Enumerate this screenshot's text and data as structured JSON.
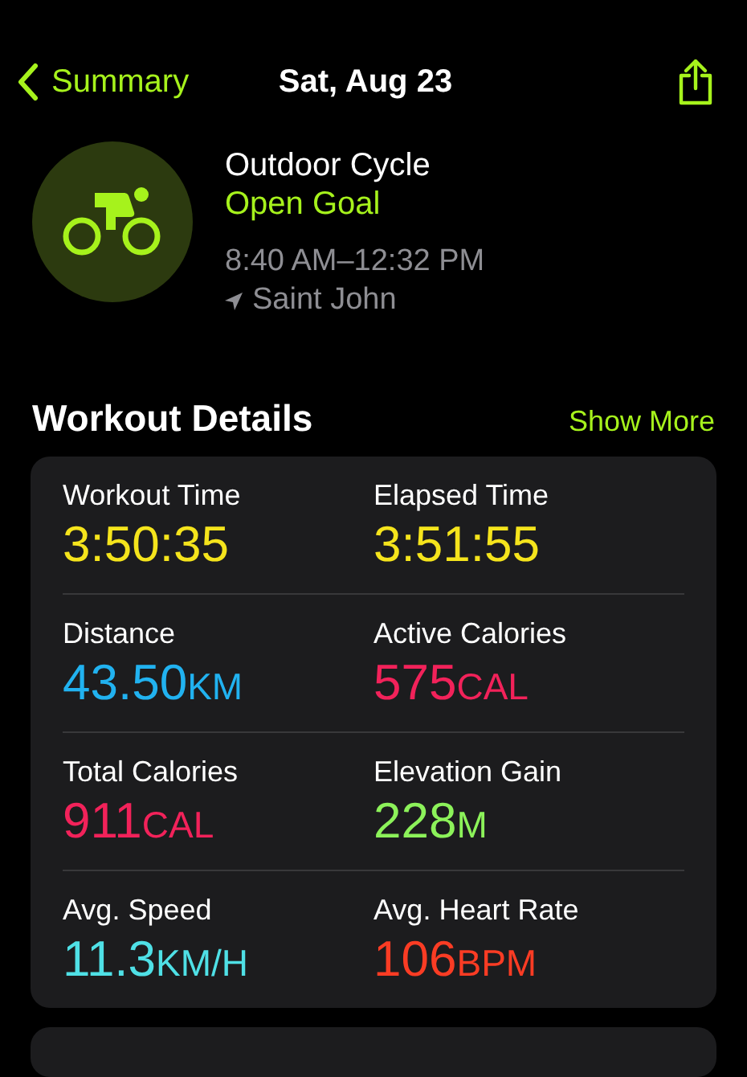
{
  "nav": {
    "back": "Summary",
    "title": "Sat, Aug 23"
  },
  "workout": {
    "name": "Outdoor Cycle",
    "goal": "Open Goal",
    "time": "8:40 AM–12:32 PM",
    "location": "Saint John"
  },
  "section": {
    "title": "Workout Details",
    "action": "Show More"
  },
  "metrics": [
    {
      "label": "Workout Time",
      "value": "3:50:35",
      "color": "#f5e41c"
    },
    {
      "label": "Elapsed Time",
      "value": "3:51:55",
      "color": "#f5e41c"
    },
    {
      "label": "Distance",
      "value": "43.50",
      "unit": "KM",
      "color": "#21b2f0"
    },
    {
      "label": "Active Calories",
      "value": "575",
      "unit": "CAL",
      "color": "#f2225a"
    },
    {
      "label": "Total Calories",
      "value": "911",
      "unit": "CAL",
      "color": "#f2225a"
    },
    {
      "label": "Elevation Gain",
      "value": "228",
      "unit": "M",
      "color": "#8cf25a"
    },
    {
      "label": "Avg. Speed",
      "value": "11.3",
      "unit": "KM/H",
      "color": "#4fe0e6"
    },
    {
      "label": "Avg. Heart Rate",
      "value": "106",
      "unit": "BPM",
      "color": "#fa3c24"
    }
  ]
}
